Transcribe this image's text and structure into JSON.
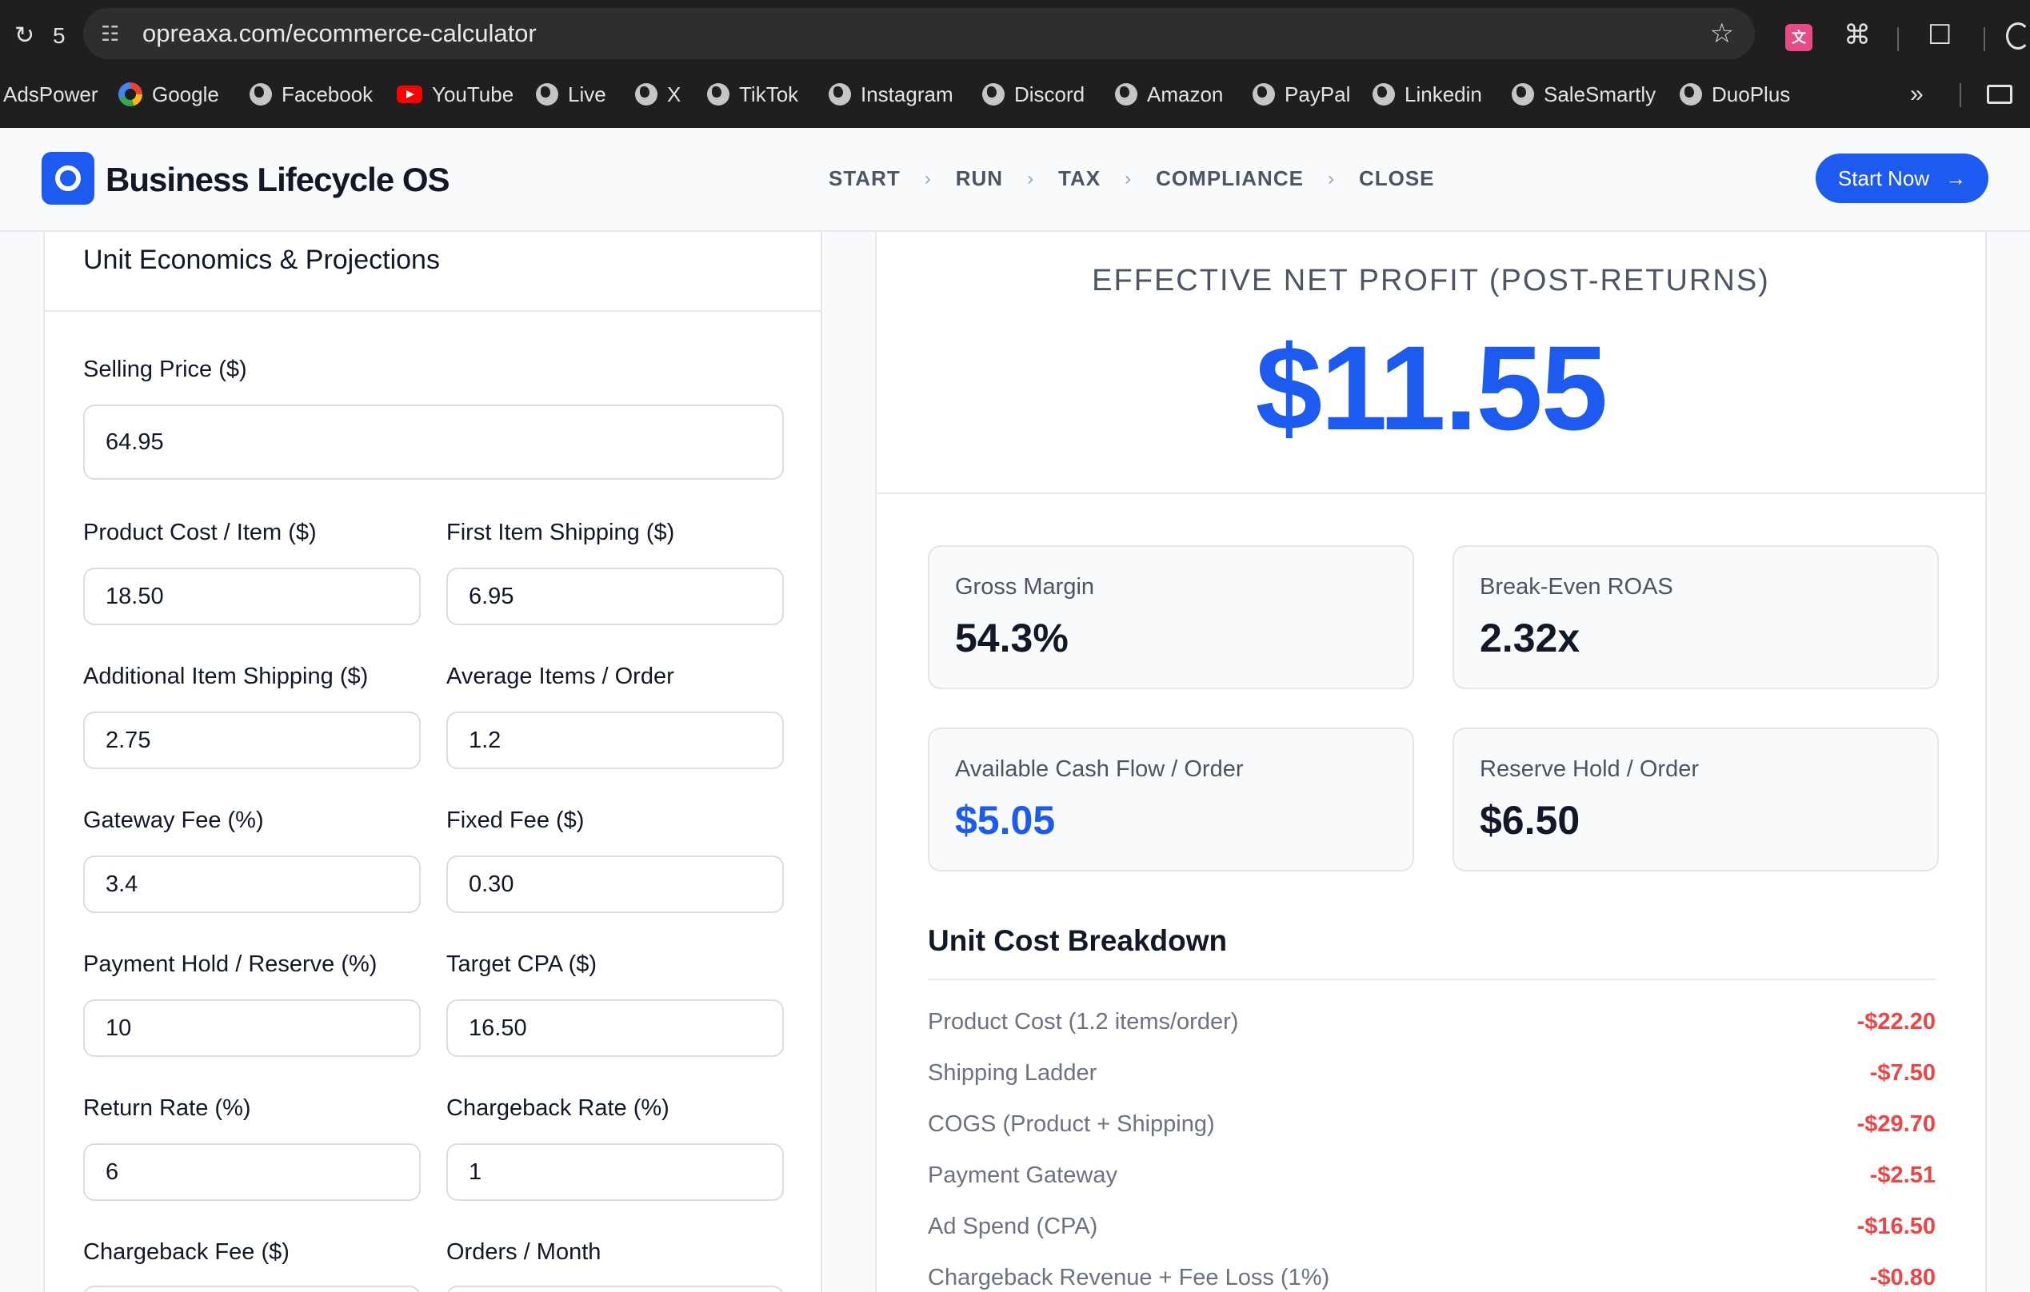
{
  "browser": {
    "tab_count": "5",
    "url": "opreaxa.com/ecommerce-calculator",
    "bookmarks": [
      "AdsPower",
      "Google",
      "Facebook",
      "YouTube",
      "Live",
      "X",
      "TikTok",
      "Instagram",
      "Discord",
      "Amazon",
      "PayPal",
      "Linkedin",
      "SaleSmartly",
      "DuoPlus"
    ]
  },
  "header": {
    "brand": "Business Lifecycle OS",
    "steps": [
      "START",
      "RUN",
      "TAX",
      "COMPLIANCE",
      "CLOSE"
    ],
    "cta": "Start Now"
  },
  "form": {
    "title": "Unit Economics & Projections",
    "fields": [
      {
        "label": "Selling Price ($)",
        "value": "64.95"
      },
      {
        "label": "Product Cost / Item ($)",
        "value": "18.50"
      },
      {
        "label": "First Item Shipping ($)",
        "value": "6.95"
      },
      {
        "label": "Additional Item Shipping ($)",
        "value": "2.75"
      },
      {
        "label": "Average Items / Order",
        "value": "1.2"
      },
      {
        "label": "Gateway Fee (%)",
        "value": "3.4"
      },
      {
        "label": "Fixed Fee ($)",
        "value": "0.30"
      },
      {
        "label": "Payment Hold / Reserve (%)",
        "value": "10"
      },
      {
        "label": "Target CPA ($)",
        "value": "16.50"
      },
      {
        "label": "Return Rate (%)",
        "value": "6"
      },
      {
        "label": "Chargeback Rate (%)",
        "value": "1"
      },
      {
        "label": "Chargeback Fee ($)",
        "value": ""
      },
      {
        "label": "Orders / Month",
        "value": ""
      }
    ]
  },
  "results": {
    "headline_label": "EFFECTIVE NET PROFIT (POST-RETURNS)",
    "headline_value": "$11.55",
    "metrics": [
      {
        "label": "Gross Margin",
        "value": "54.3%"
      },
      {
        "label": "Break-Even ROAS",
        "value": "2.32x"
      },
      {
        "label": "Available Cash Flow / Order",
        "value": "$5.05"
      },
      {
        "label": "Reserve Hold / Order",
        "value": "$6.50"
      }
    ],
    "breakdown_title": "Unit Cost Breakdown",
    "breakdown": [
      {
        "label": "Product Cost (1.2 items/order)",
        "value": "-$22.20"
      },
      {
        "label": "Shipping Ladder",
        "value": "-$7.50"
      },
      {
        "label": "COGS (Product + Shipping)",
        "value": "-$29.70"
      },
      {
        "label": "Payment Gateway",
        "value": "-$2.51"
      },
      {
        "label": "Ad Spend (CPA)",
        "value": "-$16.50"
      },
      {
        "label": "Chargeback Revenue + Fee Loss (1%)",
        "value": "-$0.80"
      }
    ]
  },
  "colors": {
    "accent": "#1d5bf0",
    "negative": "#ef4444",
    "chrome_bg": "#1f1f1f"
  }
}
